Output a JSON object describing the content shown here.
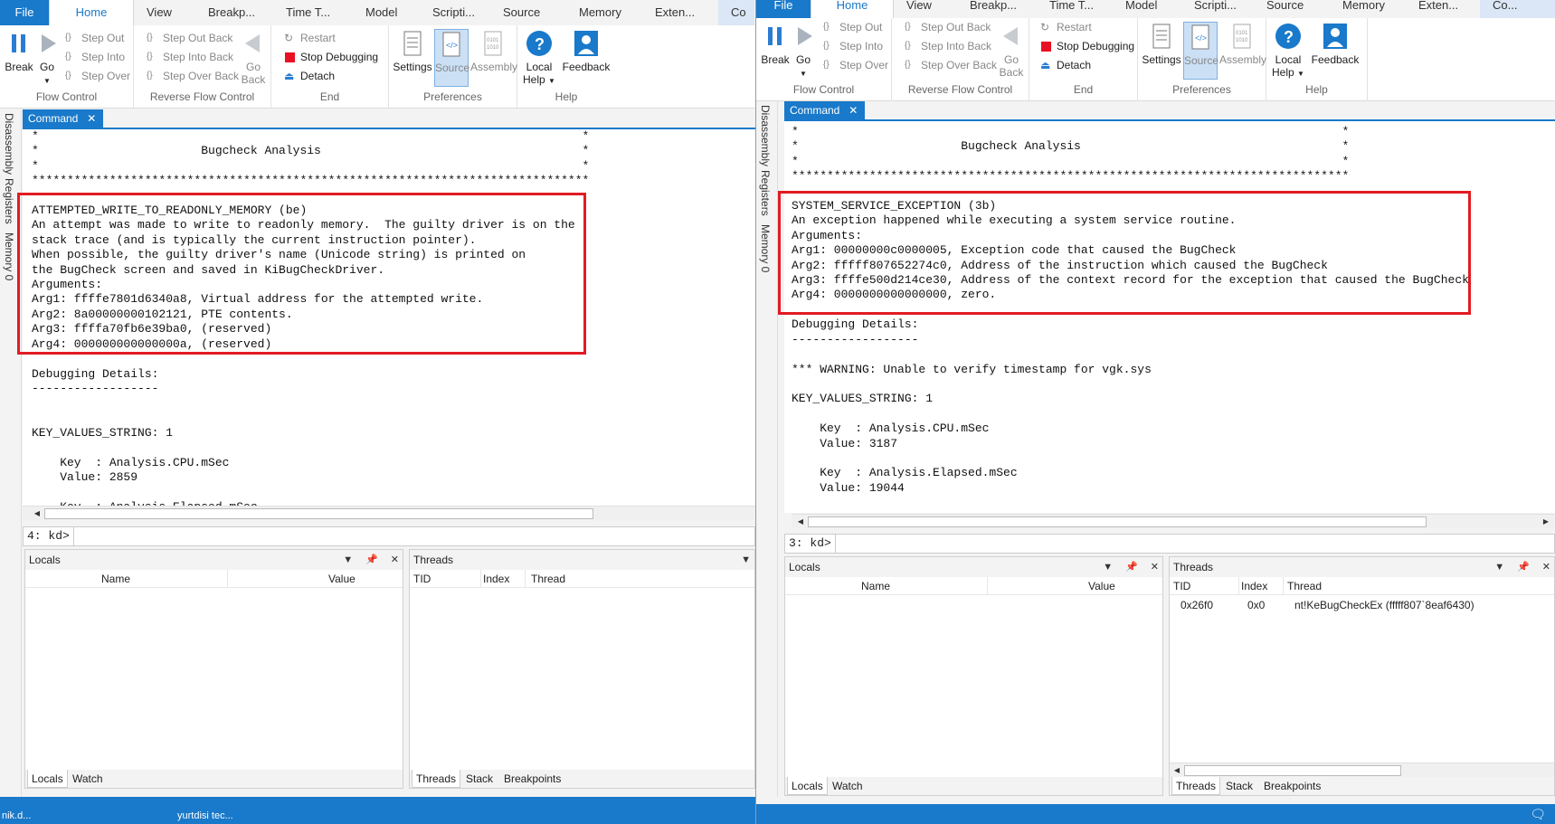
{
  "left": {
    "tabs": [
      "File",
      "Home",
      "View",
      "Breakp...",
      "Time T...",
      "Model",
      "Scripti...",
      "Source",
      "Memory",
      "Exten...",
      "Co"
    ],
    "ribbon": {
      "break": "Break",
      "go": "Go",
      "step_out": "Step Out",
      "step_into": "Step Into",
      "step_over": "Step Over",
      "step_out_back": "Step Out Back",
      "step_into_back": "Step Into Back",
      "step_over_back": "Step Over Back",
      "go_back_1": "Go",
      "go_back_2": "Back",
      "restart": "Restart",
      "stop_debugging": "Stop Debugging",
      "detach": "Detach",
      "settings": "Settings",
      "source": "Source",
      "assembly": "Assembly",
      "local_help_1": "Local",
      "local_help_2": "Help",
      "feedback": "Feedback",
      "groups": [
        "Flow Control",
        "Reverse Flow Control",
        "End",
        "Preferences",
        "Help"
      ]
    },
    "sidebar": [
      "Disassembly",
      "Registers",
      "Memory 0"
    ],
    "command_tab": "Command",
    "output_lines": [
      "*                                                                             *",
      "*                       Bugcheck Analysis                                     *",
      "*                                                                             *",
      "*******************************************************************************",
      "",
      "ATTEMPTED_WRITE_TO_READONLY_MEMORY (be)",
      "An attempt was made to write to readonly memory.  The guilty driver is on the",
      "stack trace (and is typically the current instruction pointer).",
      "When possible, the guilty driver's name (Unicode string) is printed on",
      "the BugCheck screen and saved in KiBugCheckDriver.",
      "Arguments:",
      "Arg1: ffffe7801d6340a8, Virtual address for the attempted write.",
      "Arg2: 8a00000000102121, PTE contents.",
      "Arg3: ffffa70fb6e39ba0, (reserved)",
      "Arg4: 000000000000000a, (reserved)",
      "",
      "Debugging Details:",
      "------------------",
      "",
      "",
      "KEY_VALUES_STRING: 1",
      "",
      "    Key  : Analysis.CPU.mSec",
      "    Value: 2859",
      "",
      "    Key  : Analysis.Elapsed.mSec"
    ],
    "prompt": "4: kd>",
    "locals": {
      "title": "Locals",
      "col_name": "Name",
      "col_value": "Value",
      "tab_locals": "Locals",
      "tab_watch": "Watch"
    },
    "threads": {
      "title": "Threads",
      "col_tid": "TID",
      "col_index": "Index",
      "col_thread": "Thread",
      "tab_threads": "Threads",
      "tab_stack": "Stack",
      "tab_breakpoints": "Breakpoints"
    },
    "taskbar_text": [
      "nik.d...",
      "yurtdisi tec..."
    ]
  },
  "right": {
    "tabs": [
      "File",
      "Home",
      "View",
      "Breakp...",
      "Time T...",
      "Model",
      "Scripti...",
      "Source",
      "Memory",
      "Exten...",
      "Co..."
    ],
    "ribbon": {
      "break": "Break",
      "go": "Go",
      "step_out": "Step Out",
      "step_into": "Step Into",
      "step_over": "Step Over",
      "step_out_back": "Step Out Back",
      "step_into_back": "Step Into Back",
      "step_over_back": "Step Over Back",
      "go_back_1": "Go",
      "go_back_2": "Back",
      "restart": "Restart",
      "stop_debugging": "Stop Debugging",
      "detach": "Detach",
      "settings": "Settings",
      "source": "Source",
      "assembly": "Assembly",
      "local_help_1": "Local",
      "local_help_2": "Help",
      "feedback": "Feedback",
      "groups": [
        "Flow Control",
        "Reverse Flow Control",
        "End",
        "Preferences",
        "Help"
      ]
    },
    "sidebar": [
      "Disassembly",
      "Registers",
      "Memory 0"
    ],
    "command_tab": "Command",
    "output_lines": [
      "*                                                                             *",
      "*                       Bugcheck Analysis                                     *",
      "*                                                                             *",
      "*******************************************************************************",
      "",
      "SYSTEM_SERVICE_EXCEPTION (3b)",
      "An exception happened while executing a system service routine.",
      "Arguments:",
      "Arg1: 00000000c0000005, Exception code that caused the BugCheck",
      "Arg2: fffff807652274c0, Address of the instruction which caused the BugCheck",
      "Arg3: ffffe500d214ce30, Address of the context record for the exception that caused the BugCheck",
      "Arg4: 0000000000000000, zero.",
      "",
      "Debugging Details:",
      "------------------",
      "",
      "*** WARNING: Unable to verify timestamp for vgk.sys",
      "",
      "KEY_VALUES_STRING: 1",
      "",
      "    Key  : Analysis.CPU.mSec",
      "    Value: 3187",
      "",
      "    Key  : Analysis.Elapsed.mSec",
      "    Value: 19044"
    ],
    "prompt": "3: kd>",
    "locals": {
      "title": "Locals",
      "col_name": "Name",
      "col_value": "Value",
      "tab_locals": "Locals",
      "tab_watch": "Watch"
    },
    "threads": {
      "title": "Threads",
      "col_tid": "TID",
      "col_index": "Index",
      "col_thread": "Thread",
      "row_tid": "0x26f0",
      "row_index": "0x0",
      "row_thread": "nt!KeBugCheckEx (fffff807`8eaf6430)",
      "tab_threads": "Threads",
      "tab_stack": "Stack",
      "tab_breakpoints": "Breakpoints"
    }
  },
  "colors": {
    "accent": "#1979ca",
    "highlight": "#e21b23",
    "stop": "#e81123"
  }
}
